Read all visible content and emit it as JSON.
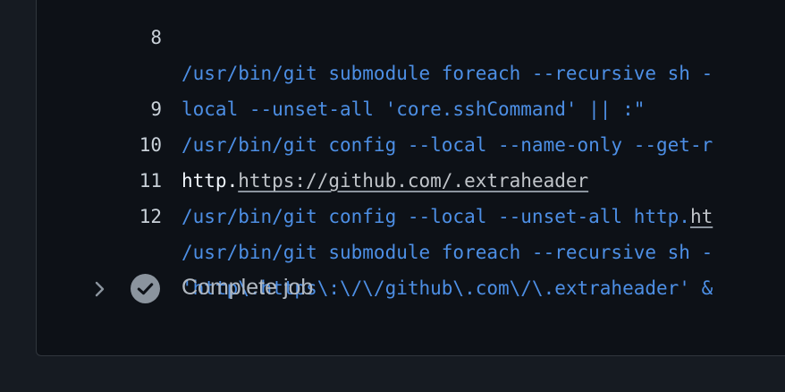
{
  "log": {
    "lines": [
      {
        "num": "8",
        "text": "/usr/bin/git submodule foreach --recursive sh -"
      },
      {
        "num": "",
        "text": "local --unset-all 'core.sshCommand' || :\""
      },
      {
        "num": "9",
        "text": "/usr/bin/git config --local --name-only --get-r"
      },
      {
        "num": "10",
        "prefix": "http.",
        "link": "https://github.com/.extraheader"
      },
      {
        "num": "11",
        "text": "/usr/bin/git config --local --unset-all http.",
        "link": "ht"
      },
      {
        "num": "12",
        "text": "/usr/bin/git submodule foreach --recursive sh -"
      },
      {
        "num": "",
        "text": "'http\\.https\\:\\/\\/github\\.com\\/\\.extraheader' &"
      }
    ]
  },
  "step": {
    "label": "Complete job",
    "status": "success",
    "icons": {
      "toggle": "chevron-right-icon",
      "status": "check-circle-icon"
    }
  },
  "colors": {
    "command": "#4d8fe5",
    "plain": "#f0f6fc",
    "line_number": "#c9d1d9",
    "background": "#0d1117"
  }
}
